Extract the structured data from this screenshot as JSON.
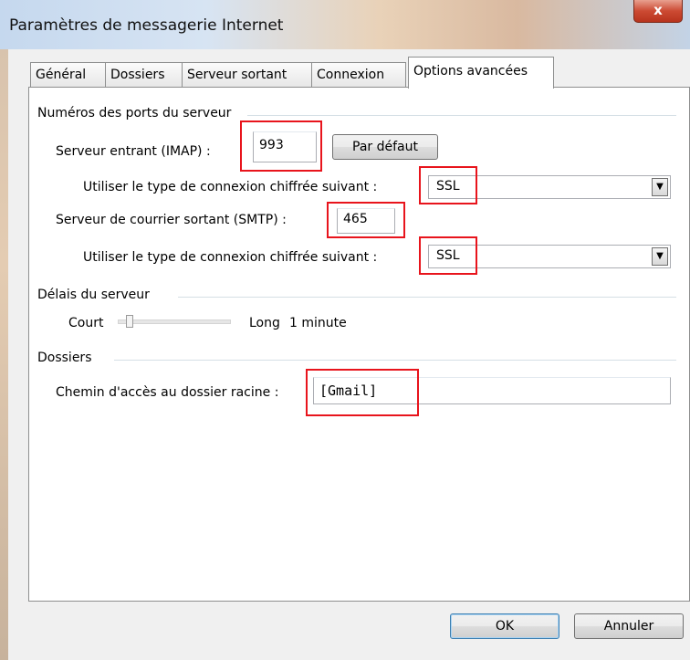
{
  "window": {
    "title": "Paramètres de messagerie Internet",
    "close_label": "x"
  },
  "tabs": [
    {
      "label": "Général",
      "active": false
    },
    {
      "label": "Dossiers",
      "active": false
    },
    {
      "label": "Serveur sortant",
      "active": false
    },
    {
      "label": "Connexion",
      "active": false
    },
    {
      "label": "Options avancées",
      "active": true
    }
  ],
  "ports": {
    "group_label": "Numéros des ports du serveur",
    "incoming_label": "Serveur entrant (IMAP) :",
    "incoming_value": "993",
    "default_button": "Par défaut",
    "incoming_encryption_label": "Utiliser le type de connexion chiffrée suivant :",
    "incoming_encryption_value": "SSL",
    "outgoing_label": "Serveur de courrier sortant (SMTP) :",
    "outgoing_value": "465",
    "outgoing_encryption_label": "Utiliser le type de connexion chiffrée suivant :",
    "outgoing_encryption_value": "SSL"
  },
  "timeout": {
    "group_label": "Délais du serveur",
    "short_label": "Court",
    "long_label": "Long",
    "value_text": "1 minute",
    "slider_fraction": 0.08
  },
  "folders": {
    "group_label": "Dossiers",
    "root_path_label": "Chemin d'accès au dossier racine :",
    "root_path_value": "[Gmail]"
  },
  "buttons": {
    "ok": "OK",
    "cancel": "Annuler"
  },
  "colors": {
    "highlight": "#e8141c"
  }
}
